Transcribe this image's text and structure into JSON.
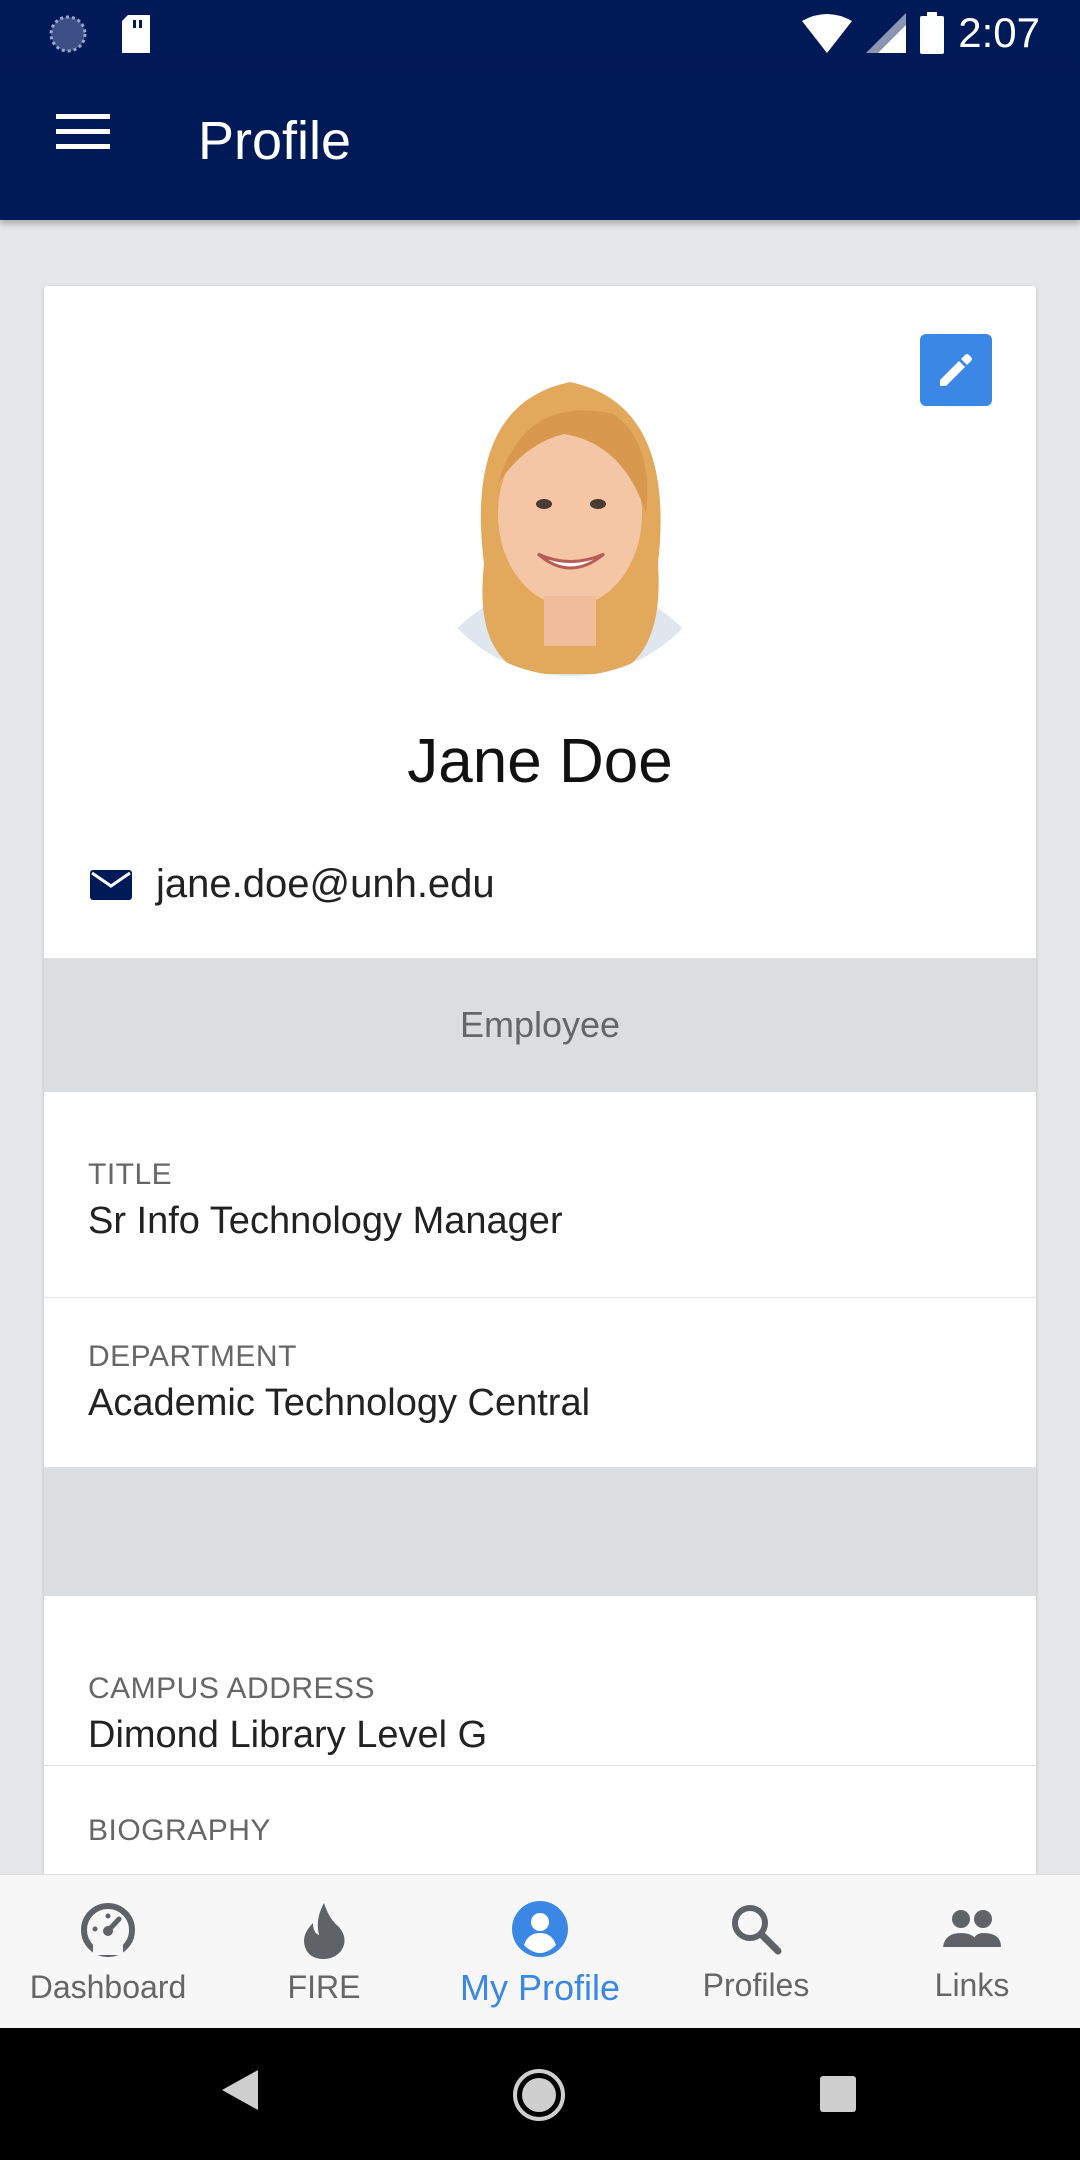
{
  "status_bar": {
    "time": "2:07"
  },
  "app_bar": {
    "title": "Profile"
  },
  "profile": {
    "name": "Jane Doe",
    "email": "jane.doe@unh.edu",
    "affiliation": "Employee",
    "fields": [
      {
        "label": "TITLE",
        "value": "Sr Info Technology Manager"
      },
      {
        "label": "DEPARTMENT",
        "value": "Academic Technology Central"
      },
      {
        "label": "CAMPUS ADDRESS",
        "value": "Dimond Library Level G"
      },
      {
        "label": "BIOGRAPHY",
        "value": ""
      }
    ]
  },
  "bottom_nav": {
    "items": [
      {
        "label": "Dashboard",
        "icon": "speedometer-icon"
      },
      {
        "label": "FIRE",
        "icon": "flame-icon"
      },
      {
        "label": "My Profile",
        "icon": "account-circle-icon",
        "active": true
      },
      {
        "label": "Profiles",
        "icon": "search-icon"
      },
      {
        "label": "Links",
        "icon": "people-icon"
      }
    ]
  },
  "colors": {
    "primary": "#001a57",
    "accent": "#3a87e6",
    "band": "#dcdddf"
  }
}
